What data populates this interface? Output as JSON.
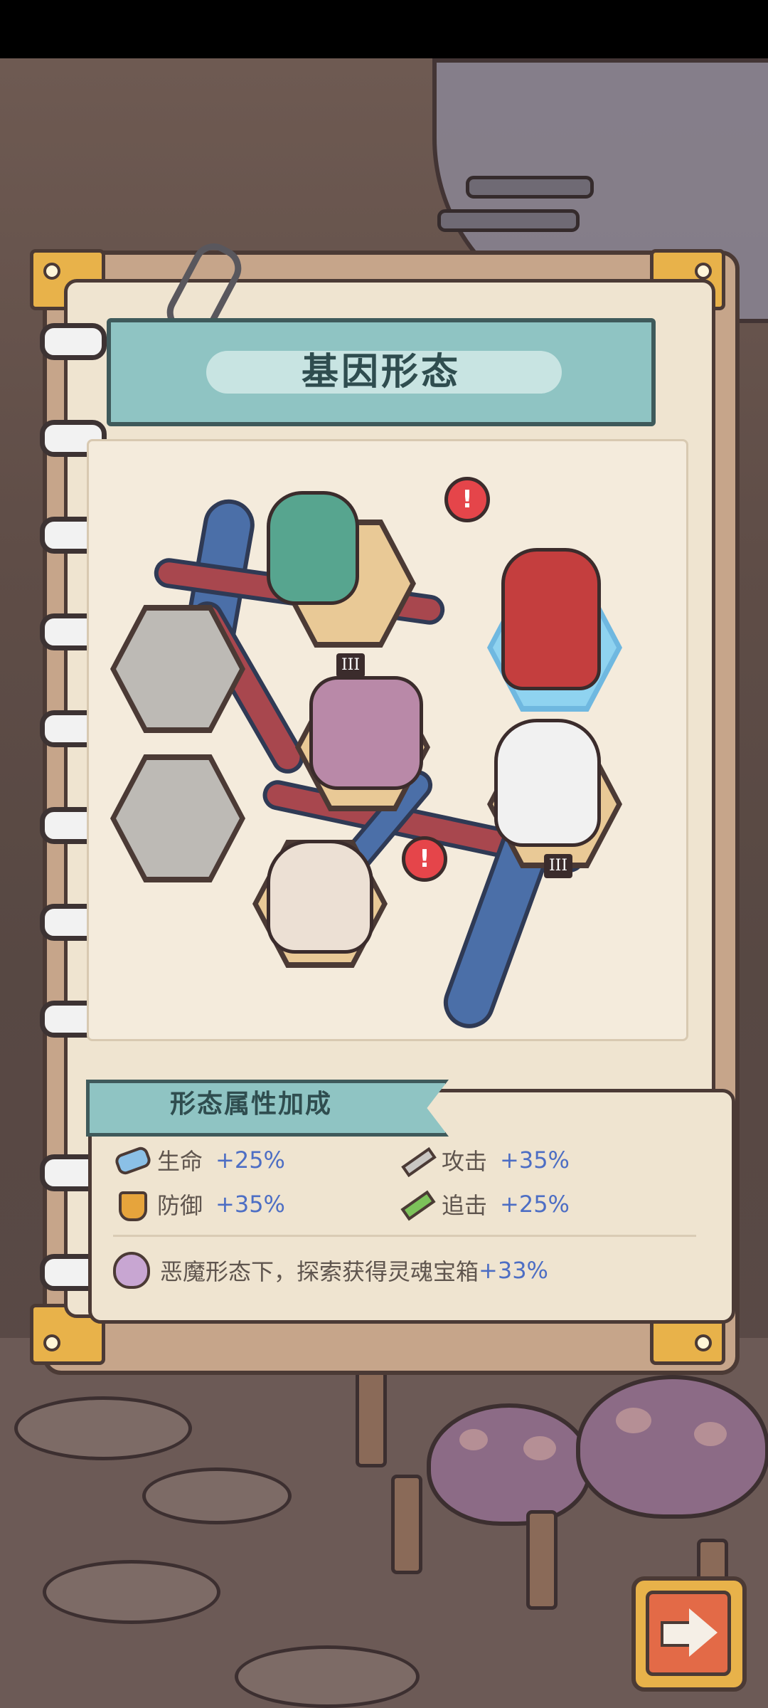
{
  "screen": {
    "title": "基因形态",
    "attributes_heading": "形态属性加成"
  },
  "stats": [
    {
      "name": "生命",
      "value": "+25%",
      "icon": "health-pill-icon"
    },
    {
      "name": "攻击",
      "value": "+35%",
      "icon": "attack-sword-icon"
    },
    {
      "name": "防御",
      "value": "+35%",
      "icon": "defense-shield-icon"
    },
    {
      "name": "追击",
      "value": "+25%",
      "icon": "pursuit-arrow-icon"
    }
  ],
  "bonus": {
    "prefix": "恶魔形态下，探索获得灵魂宝箱",
    "value": "+33%",
    "icon": "soul-bag-icon"
  },
  "gene_forms": [
    {
      "name": "zombie",
      "tier": "III",
      "alert": "!"
    },
    {
      "name": "demon",
      "selected": true
    },
    {
      "name": "mech"
    },
    {
      "name": "angel",
      "tier": "III"
    },
    {
      "name": "basic",
      "alert": "!"
    },
    {
      "name": "locked-1",
      "locked": true
    },
    {
      "name": "locked-2",
      "locked": true
    }
  ],
  "colors": {
    "accent_blue": "#4d6ec4",
    "banner": "#8fc4c3",
    "alert": "#e5454a",
    "gold": "#e8b24a"
  }
}
